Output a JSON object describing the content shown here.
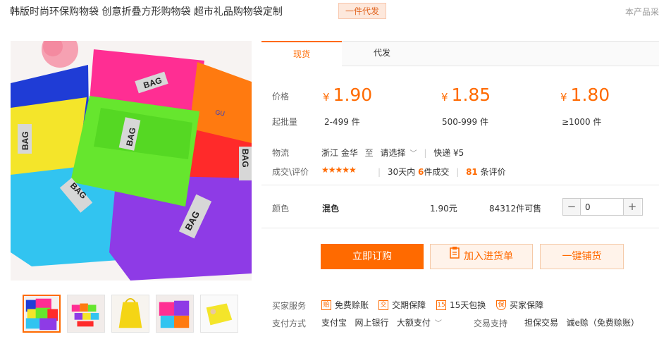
{
  "header": {
    "title": "韩版时尚环保购物袋 创意折叠方形购物袋 超市礼品购物袋定制",
    "badge": "一件代发",
    "right_note": "本产品采"
  },
  "tabs": [
    {
      "label": "现货",
      "active": true
    },
    {
      "label": "代发",
      "active": false
    }
  ],
  "pricing": {
    "price_label": "价格",
    "qty_label": "起批量",
    "currency": "¥",
    "tiers": [
      {
        "price": "1.90",
        "qty": "2-499 件"
      },
      {
        "price": "1.85",
        "qty": "500-999 件"
      },
      {
        "price": "1.80",
        "qty": "≥1000 件"
      }
    ]
  },
  "logistics": {
    "label": "物流",
    "origin": "浙江 金华",
    "to": "至",
    "select": "请选择",
    "express": "快递 ¥5"
  },
  "reviews": {
    "label": "成交\\评价",
    "stars": "★★★★★",
    "sold_prefix": "30天内",
    "sold_count": "6",
    "sold_suffix": "件成交",
    "review_count": "81",
    "review_suffix": "条评价"
  },
  "sku": {
    "label": "颜色",
    "name": "混色",
    "price": "1.90元",
    "stock": "84312件可售",
    "quantity": "0",
    "minus": "−",
    "plus": "+"
  },
  "actions": {
    "buy": "立即订购",
    "cart": "加入进货单",
    "distribute": "一键铺货"
  },
  "services": {
    "label": "买家服务",
    "items": [
      {
        "icon": "赔",
        "text": "免费赊账"
      },
      {
        "icon": "交",
        "text": "交期保障"
      },
      {
        "icon": "15",
        "text": "15天包换"
      },
      {
        "icon": "保",
        "text": "买家保障"
      }
    ]
  },
  "payment": {
    "label": "支付方式",
    "methods": "支付宝   网上银行   大额支付",
    "trade_label": "交易支持",
    "trade_items": "担保交易   诚e赊（免费赊账）"
  },
  "image": {
    "bag_text": "BAG",
    "colors": [
      "#ff2e93",
      "#ff7a10",
      "#ff9999",
      "#1f3cd6",
      "#f4e52a",
      "#66e62e",
      "#ff2a2a",
      "#32c4f0",
      "#8e3be6"
    ]
  }
}
